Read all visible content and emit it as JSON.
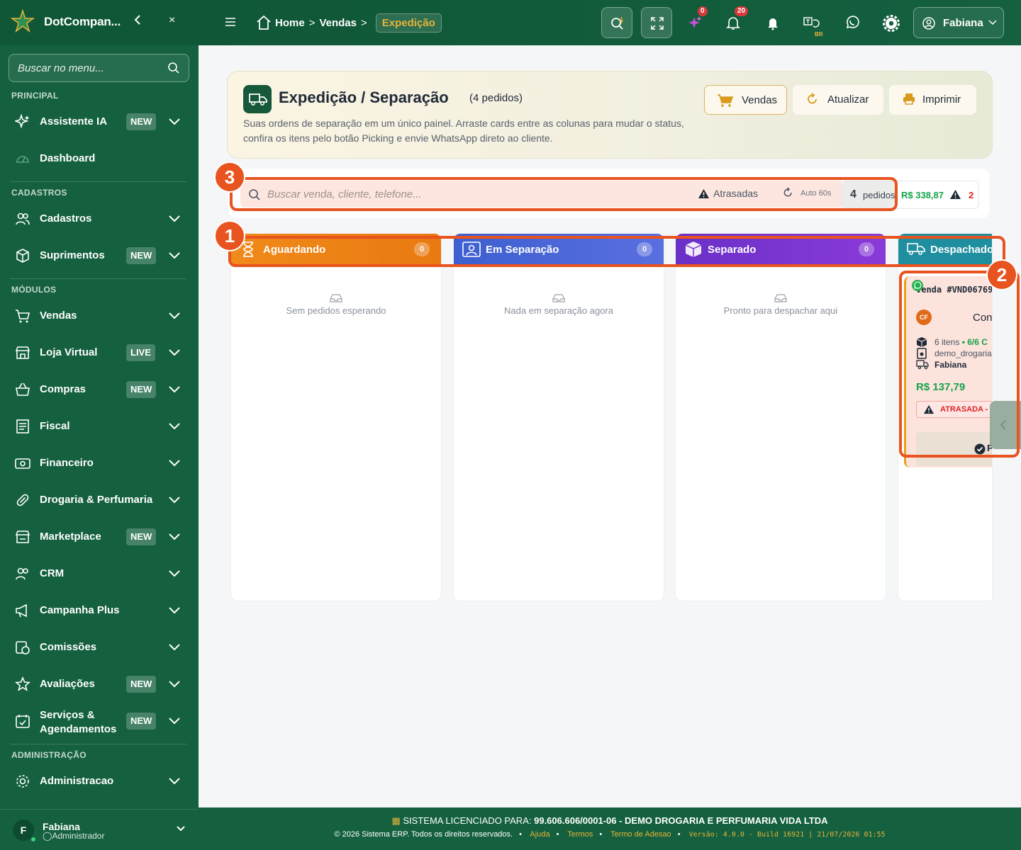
{
  "brand": {
    "name": "DotCompan...",
    "collapse_icon": "chevron-left-icon",
    "close_label": "×"
  },
  "sidebar": {
    "search_placeholder": "Buscar no menu...",
    "sections": {
      "principal": "PRINCIPAL",
      "cadastros": "CADASTROS",
      "modulos": "MÓDULOS",
      "administracao": "ADMINISTRAÇÃO"
    },
    "items": [
      {
        "label": "Assistente IA",
        "badge": "NEW",
        "icon": "sparkles-icon"
      },
      {
        "label": "Dashboard",
        "icon": "gauge-icon"
      },
      {
        "label": "Cadastros",
        "icon": "users-icon"
      },
      {
        "label": "Suprimentos",
        "badge": "NEW",
        "icon": "box-icon"
      },
      {
        "label": "Vendas",
        "icon": "cart-icon"
      },
      {
        "label": "Loja Virtual",
        "badge": "LIVE",
        "icon": "store-icon"
      },
      {
        "label": "Compras",
        "badge": "NEW",
        "icon": "basket-icon"
      },
      {
        "label": "Fiscal",
        "icon": "document-icon"
      },
      {
        "label": "Financeiro",
        "icon": "money-icon"
      },
      {
        "label": "Drogaria & Perfumaria",
        "icon": "pill-icon"
      },
      {
        "label": "Marketplace",
        "badge": "NEW",
        "icon": "shop-icon"
      },
      {
        "label": "CRM",
        "icon": "users-icon"
      },
      {
        "label": "Campanha Plus",
        "icon": "megaphone-icon"
      },
      {
        "label": "Comissões",
        "icon": "coins-icon"
      },
      {
        "label": "Avaliações",
        "badge": "NEW",
        "icon": "star-icon"
      },
      {
        "label": "Serviços &",
        "label2": "Agendamentos",
        "badge": "NEW",
        "icon": "calendar-icon"
      },
      {
        "label": "Administracao",
        "icon": "gear-icon"
      }
    ],
    "user": {
      "initial": "F",
      "name": "Fabiana",
      "role": "Administrador"
    }
  },
  "topbar": {
    "breadcrumb": [
      "Home",
      "Vendas",
      "Expedição"
    ],
    "notif_ai": "0",
    "notif_bell": "20",
    "lang_tag": "BR",
    "user_name": "Fabiana"
  },
  "hero": {
    "title": "Expedição / Separação",
    "count": "(4 pedidos)",
    "description": "Suas ordens de separação em um único painel. Arraste cards entre as colunas para mudar o status, confira os itens pelo botão Picking e envie WhatsApp direto ao cliente.",
    "buttons": {
      "vendas": "Vendas",
      "atualizar": "Atualizar",
      "imprimir": "Imprimir"
    }
  },
  "filters": {
    "search_placeholder": "Buscar venda, cliente, telefone...",
    "atrasadas": "Atrasadas",
    "auto": "Auto 60s",
    "count_num": "4",
    "count_label": "pedidos",
    "total": "R$ 338,87",
    "late_count": "2"
  },
  "columns": [
    {
      "title": "Aguardando",
      "count": "0",
      "empty": "Sem pedidos esperando",
      "color": "#f08a1a"
    },
    {
      "title": "Em Separação",
      "count": "0",
      "empty": "Nada em separação agora",
      "color": "#3d5fd0"
    },
    {
      "title": "Separado",
      "count": "0",
      "empty": "Pronto para despachar aqui",
      "color": "#6a30c8"
    },
    {
      "title": "Despachado",
      "color": "#1f8f9f"
    }
  ],
  "card": {
    "id": "Venda #VND06769",
    "initials": "CF",
    "customer": "Con",
    "items": "6 itens",
    "picked": "• 6/6 C",
    "store": "demo_drogaria",
    "seller": "Fabiana",
    "amount": "R$ 137,79",
    "late": "ATRASADA -",
    "action": "F"
  },
  "annotations": [
    "1",
    "2",
    "3"
  ],
  "footer": {
    "license_label": "SISTEMA LICENCIADO PARA:",
    "license_value": "99.606.606/0001-06 - DEMO DROGARIA E PERFUMARIA VIDA LTDA",
    "copyright": "© 2026 Sistema ERP. Todos os direitos reservados.",
    "links": [
      "Ajuda",
      "Termos",
      "Termo de Adesao"
    ],
    "version": "Versão: 4.0.0 - Build 16921 | 21/07/2026 01:55"
  },
  "colors": {
    "primary": "#14603f",
    "accent": "#e6b33a",
    "highlight": "#e8531f"
  }
}
